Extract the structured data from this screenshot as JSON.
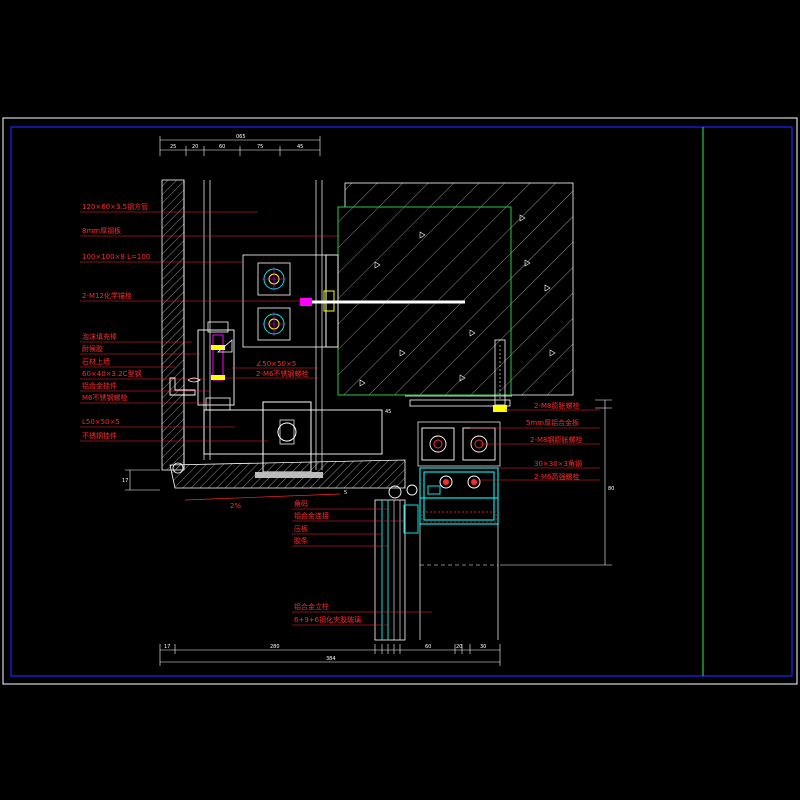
{
  "colors": {
    "background": "#000000",
    "frame": "#2222ff",
    "divider": "#22cc44",
    "label": "#ff2a2a",
    "dimension": "#ffffff",
    "profile": "#00e5e5",
    "concrete": "#ffffff",
    "insulation": "#e5e5e5"
  },
  "labels_left": [
    "120×60×3.5钢方管",
    "8mm厚钢板",
    "100×100×8  L=100",
    "2-M12化学锚栓",
    "泡沫填充棒",
    "耐候胶",
    "石材上墙",
    "60×40×3.2C型钢",
    "铝合金挂件",
    "M6不锈钢螺栓",
    "L50×50×5",
    "不锈钢挂件"
  ],
  "labels_mid": [
    "∠50×50×5",
    "2-M6不锈钢螺栓"
  ],
  "labels_right": [
    "2-M8膨胀螺栓",
    "5mm厚铝合金板",
    "2-M8钢膨胀螺栓",
    "30×30×3角钢",
    "2-M6高强螺栓"
  ],
  "labels_bottom_mid": [
    "角码",
    "铝合金连接",
    "压板",
    "胶条"
  ],
  "labels_bottom": [
    "铝合金立柱",
    "6+9+6钢化夹胶玻璃"
  ],
  "slope_label": "2%",
  "top_dims": [
    "25",
    "20",
    "60",
    "75",
    "45"
  ],
  "top_total": "065",
  "bottom_dims": [
    "17",
    "280",
    "60",
    "20",
    "30"
  ],
  "bottom_total": "384",
  "right_dim": "80",
  "left_dim": "17",
  "angle_label": "45",
  "gap_label": "5"
}
